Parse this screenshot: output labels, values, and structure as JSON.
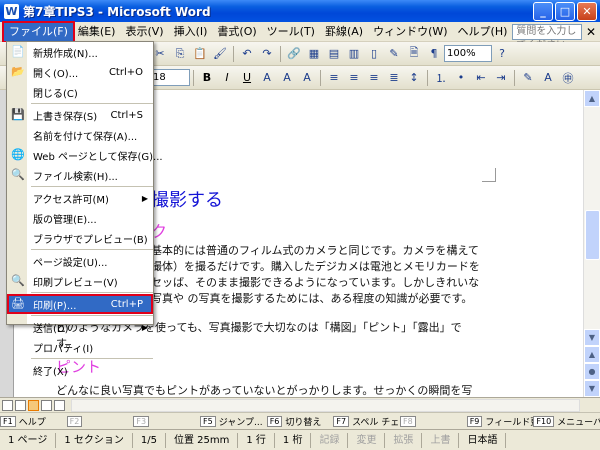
{
  "window": {
    "title": "第7章TIPS3 - Microsoft Word",
    "app_icon": "W"
  },
  "window_buttons": {
    "minimize": "_",
    "maximize": "□",
    "close": "✕"
  },
  "menubar": {
    "items": [
      "ファイル(F)",
      "編集(E)",
      "表示(V)",
      "挿入(I)",
      "書式(O)",
      "ツール(T)",
      "罫線(A)",
      "ウィンドウ(W)",
      "ヘルプ(H)"
    ],
    "help_placeholder": "質問を入力してください",
    "close": "✕"
  },
  "toolbar": {
    "font_size": "18",
    "zoom": "100%",
    "bold": "B",
    "italic": "I",
    "underline": "U"
  },
  "file_menu": {
    "items": [
      {
        "label": "新規作成(N)...",
        "shortcut": "",
        "icon": "📄",
        "arrow": false
      },
      {
        "label": "開く(O)...",
        "shortcut": "Ctrl+O",
        "icon": "📂",
        "arrow": false
      },
      {
        "label": "閉じる(C)",
        "shortcut": "",
        "icon": "",
        "arrow": false
      },
      {
        "label": "上書き保存(S)",
        "shortcut": "Ctrl+S",
        "icon": "💾",
        "arrow": false
      },
      {
        "label": "名前を付けて保存(A)...",
        "shortcut": "",
        "icon": "",
        "arrow": false
      },
      {
        "label": "Web ページとして保存(G)...",
        "shortcut": "",
        "icon": "🌐",
        "arrow": false
      },
      {
        "label": "ファイル検索(H)...",
        "shortcut": "",
        "icon": "🔍",
        "arrow": false
      },
      {
        "label": "アクセス許可(M)",
        "shortcut": "",
        "icon": "",
        "arrow": true
      },
      {
        "label": "版の管理(E)...",
        "shortcut": "",
        "icon": "",
        "arrow": false
      },
      {
        "label": "ブラウザでプレビュー(B)",
        "shortcut": "",
        "icon": "",
        "arrow": false
      },
      {
        "label": "ページ設定(U)...",
        "shortcut": "",
        "icon": "",
        "arrow": false
      },
      {
        "label": "印刷プレビュー(V)",
        "shortcut": "",
        "icon": "🔍",
        "arrow": false
      },
      {
        "label": "印刷(P)...",
        "shortcut": "Ctrl+P",
        "icon": "🖨",
        "arrow": false
      },
      {
        "label": "送信(D)",
        "shortcut": "",
        "icon": "",
        "arrow": true
      },
      {
        "label": "プロパティ(I)",
        "shortcut": "",
        "icon": "",
        "arrow": false
      },
      {
        "label": "終了(X)",
        "shortcut": "",
        "icon": "",
        "arrow": false
      }
    ]
  },
  "document": {
    "heading1": "撮影する",
    "heading2": "ク",
    "para1": "基本的には普通のフィルム式のカメラと同じです。カメラを構えて撮体）を撮るだけです。購入したデジカメは電池とメモリカードをセッば、そのまま撮影できるようになっています。しかしきれいな写真や の写真を撮影するためには、ある程度の知識が必要です。",
    "para2": "どのようなカメラを使っても、写真撮影で大切なのは「構図」「ピント」「露出」です。",
    "heading3": "ピント",
    "para3": "どんなに良い写真でもピントがあっていないとがっかりします。せっかくの瞬間を写真に"
  },
  "fkeys": [
    {
      "key": "F1",
      "label": "ヘルプ",
      "disabled": false
    },
    {
      "key": "F2",
      "label": "",
      "disabled": true
    },
    {
      "key": "F3",
      "label": "",
      "disabled": true
    },
    {
      "key": "F5",
      "label": "ジャンプ...",
      "disabled": false
    },
    {
      "key": "F6",
      "label": "切り替え",
      "disabled": false
    },
    {
      "key": "F7",
      "label": "スペル チェック...",
      "disabled": false
    },
    {
      "key": "F8",
      "label": "",
      "disabled": true
    },
    {
      "key": "F9",
      "label": "フィールド更新",
      "disabled": false
    },
    {
      "key": "F10",
      "label": "メニューバーに",
      "disabled": false
    }
  ],
  "status": {
    "page": "1 ページ",
    "section": "1 セクション",
    "pages": "1/5",
    "position": "位置 25mm",
    "line": "1 行",
    "col": "1 桁",
    "rec": "記録",
    "trk": "変更",
    "ext": "拡張",
    "ovr": "上書",
    "lang": "日本語"
  }
}
